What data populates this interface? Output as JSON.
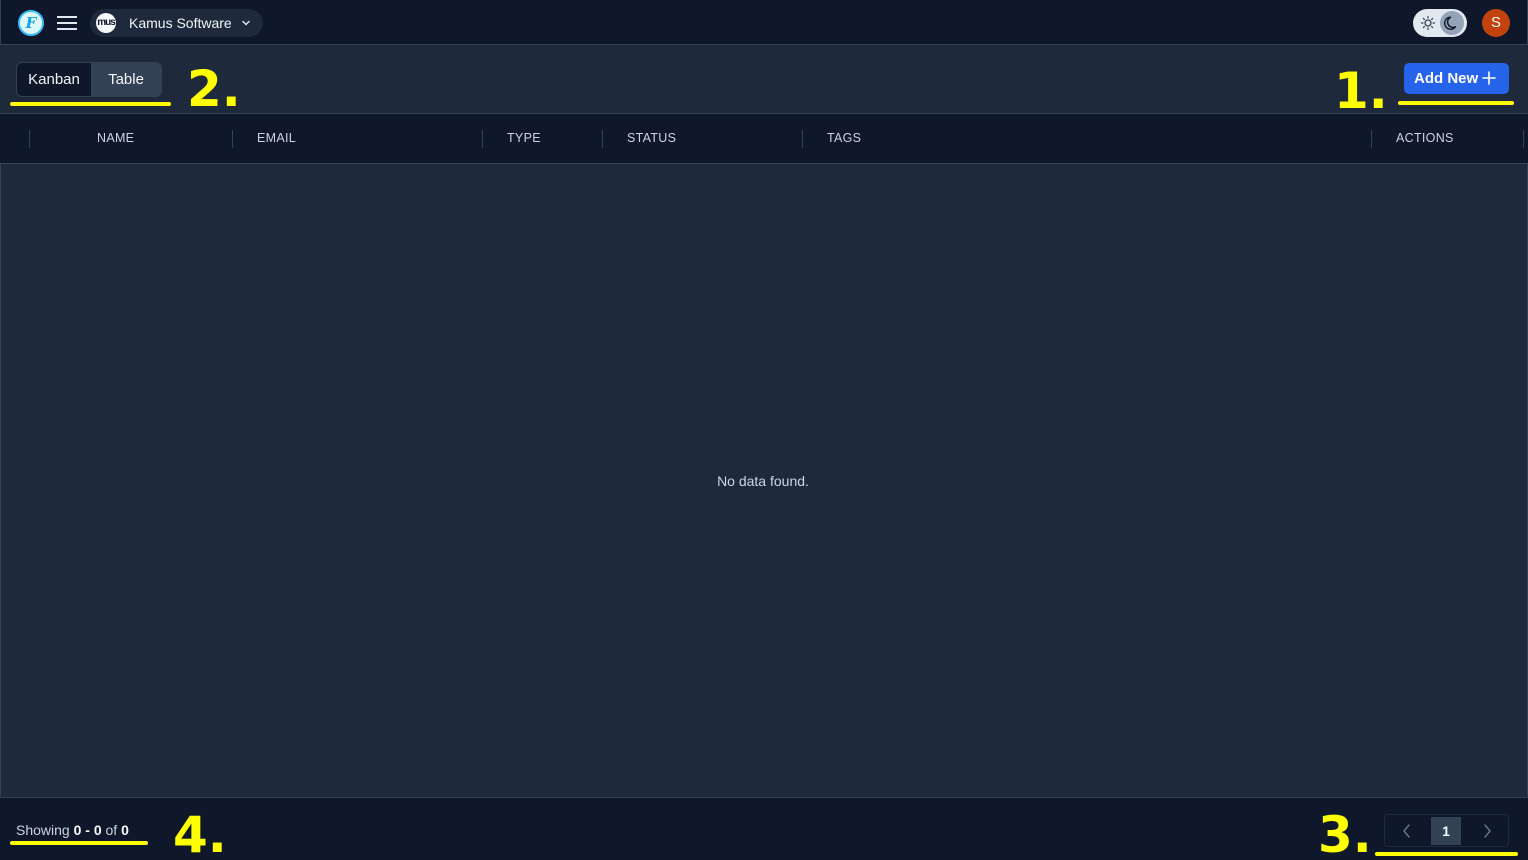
{
  "header": {
    "logo_letter": "F",
    "org_avatar_text": "mus",
    "org_name": "Kamus Software",
    "user_initial": "S"
  },
  "toolbar": {
    "views": [
      {
        "label": "Kanban",
        "active": false
      },
      {
        "label": "Table",
        "active": true
      }
    ],
    "add_label": "Add New"
  },
  "table": {
    "columns": [
      "NAME",
      "EMAIL",
      "TYPE",
      "STATUS",
      "TAGS",
      "ACTIONS"
    ],
    "rows": [],
    "empty_message": "No data found."
  },
  "footer": {
    "showing_prefix": "Showing",
    "range": "0 - 0",
    "of_label": "of",
    "total": "0",
    "current_page": "1"
  },
  "annotations": [
    "1.",
    "2.",
    "3.",
    "4."
  ],
  "colors": {
    "background": "#1e293b",
    "surface": "#0f172a",
    "accent": "#2563eb",
    "avatar": "#c2410c",
    "annotation": "#ffff00"
  }
}
